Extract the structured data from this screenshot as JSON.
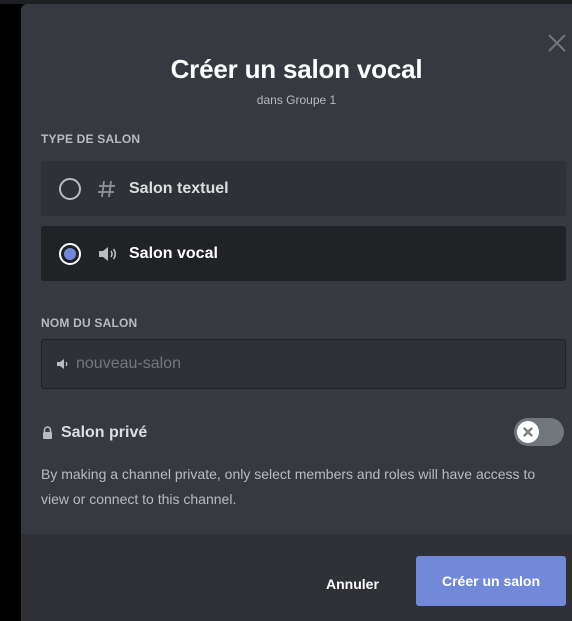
{
  "modal": {
    "title": "Créer un salon vocal",
    "subtitle": "dans Groupe 1",
    "close_icon": "close-icon"
  },
  "channel_type": {
    "label": "TYPE DE SALON",
    "options": [
      {
        "label": "Salon textuel",
        "icon": "hash-icon",
        "selected": false
      },
      {
        "label": "Salon vocal",
        "icon": "speaker-icon",
        "selected": true
      }
    ]
  },
  "channel_name": {
    "label": "NOM DU SALON",
    "placeholder": "nouveau-salon",
    "value": "",
    "icon": "speaker-icon"
  },
  "private": {
    "label": "Salon privé",
    "icon": "lock-icon",
    "enabled": false,
    "description": "By making a channel private, only select members and roles will have access to view or connect to this channel."
  },
  "footer": {
    "cancel_label": "Annuler",
    "create_label": "Créer un salon"
  },
  "colors": {
    "modal_bg": "#36393f",
    "accent": "#7289da",
    "selected_option_bg": "#202225",
    "option_bg": "#2f3136"
  }
}
